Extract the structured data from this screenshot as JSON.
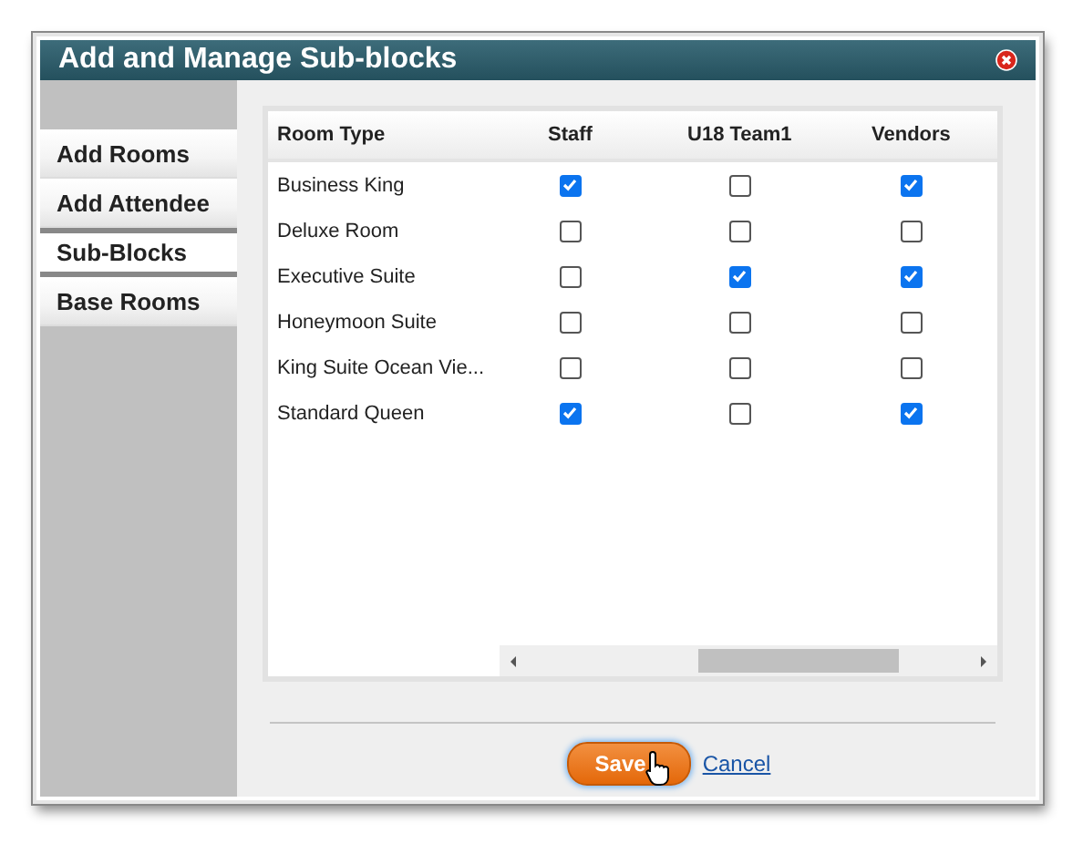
{
  "window": {
    "title": "Add and Manage Sub-blocks"
  },
  "sidebar": {
    "items": [
      {
        "label": "Add Rooms",
        "selected": false
      },
      {
        "label": "Add Attendee",
        "selected": false
      },
      {
        "label": "Sub-Blocks",
        "selected": true
      },
      {
        "label": "Base Rooms",
        "selected": false
      }
    ]
  },
  "table": {
    "columns": [
      "Room Type",
      "Staff",
      "U18 Team1",
      "Vendors"
    ],
    "rows": [
      {
        "name": "Business King",
        "checks": [
          true,
          false,
          true
        ]
      },
      {
        "name": "Deluxe Room",
        "checks": [
          false,
          false,
          false
        ]
      },
      {
        "name": "Executive Suite",
        "checks": [
          false,
          true,
          true
        ]
      },
      {
        "name": "Honeymoon Suite",
        "checks": [
          false,
          false,
          false
        ]
      },
      {
        "name": "King Suite Ocean Vie...",
        "checks": [
          false,
          false,
          false
        ]
      },
      {
        "name": "Standard Queen",
        "checks": [
          true,
          false,
          true
        ]
      }
    ]
  },
  "buttons": {
    "save": "Save",
    "cancel": "Cancel"
  }
}
